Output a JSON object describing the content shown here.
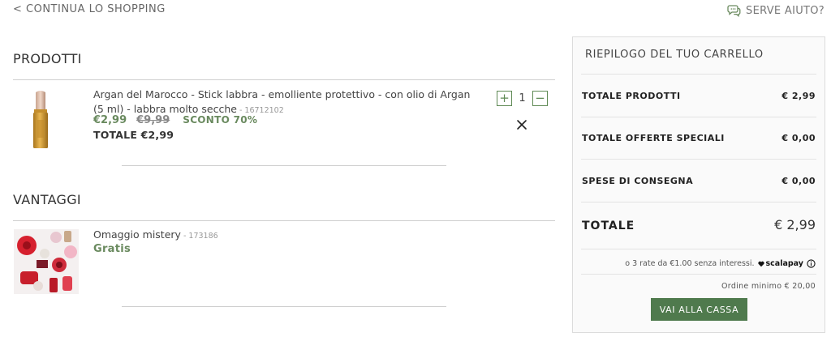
{
  "header": {
    "back_label": "< CONTINUA LO SHOPPING",
    "help_label": "SERVE AIUTO?"
  },
  "products": {
    "title": "PRODOTTI",
    "items": [
      {
        "name": "Argan del Marocco - Stick labbra - emolliente protettivo - con olio di Argan (5 ml) - labbra molto secche",
        "code": " - 16712102",
        "price": "€2,99",
        "old_price": "€9,99",
        "discount": "SCONTO 70%",
        "total": "TOTALE €2,99",
        "quantity": "1",
        "plus_label": "+",
        "minus_label": "−"
      }
    ]
  },
  "advantages": {
    "title": "VANTAGGI",
    "items": [
      {
        "name": "Omaggio mistery",
        "code": " - 173186",
        "price_label": "Gratis"
      }
    ]
  },
  "summary": {
    "title": "RIEPILOGO DEL TUO CARRELLO",
    "rows": [
      {
        "label": "TOTALE PRODOTTI",
        "value": "€ 2,99"
      },
      {
        "label": "TOTALE OFFERTE SPECIALI",
        "value": "€ 0,00"
      },
      {
        "label": "SPESE DI CONSEGNA",
        "value": "€ 0,00"
      }
    ],
    "total_label": "TOTALE",
    "total_value": "€ 2,99",
    "installments": "o 3 rate da €1.00 senza interessi.",
    "scalapay": "scalapay",
    "min_order": "Ordine minimo € 20,00",
    "checkout_label": "VAI ALLA CASSA"
  },
  "colors": {
    "accent_green": "#6a8a5f",
    "button_green": "#4f7a4d"
  }
}
